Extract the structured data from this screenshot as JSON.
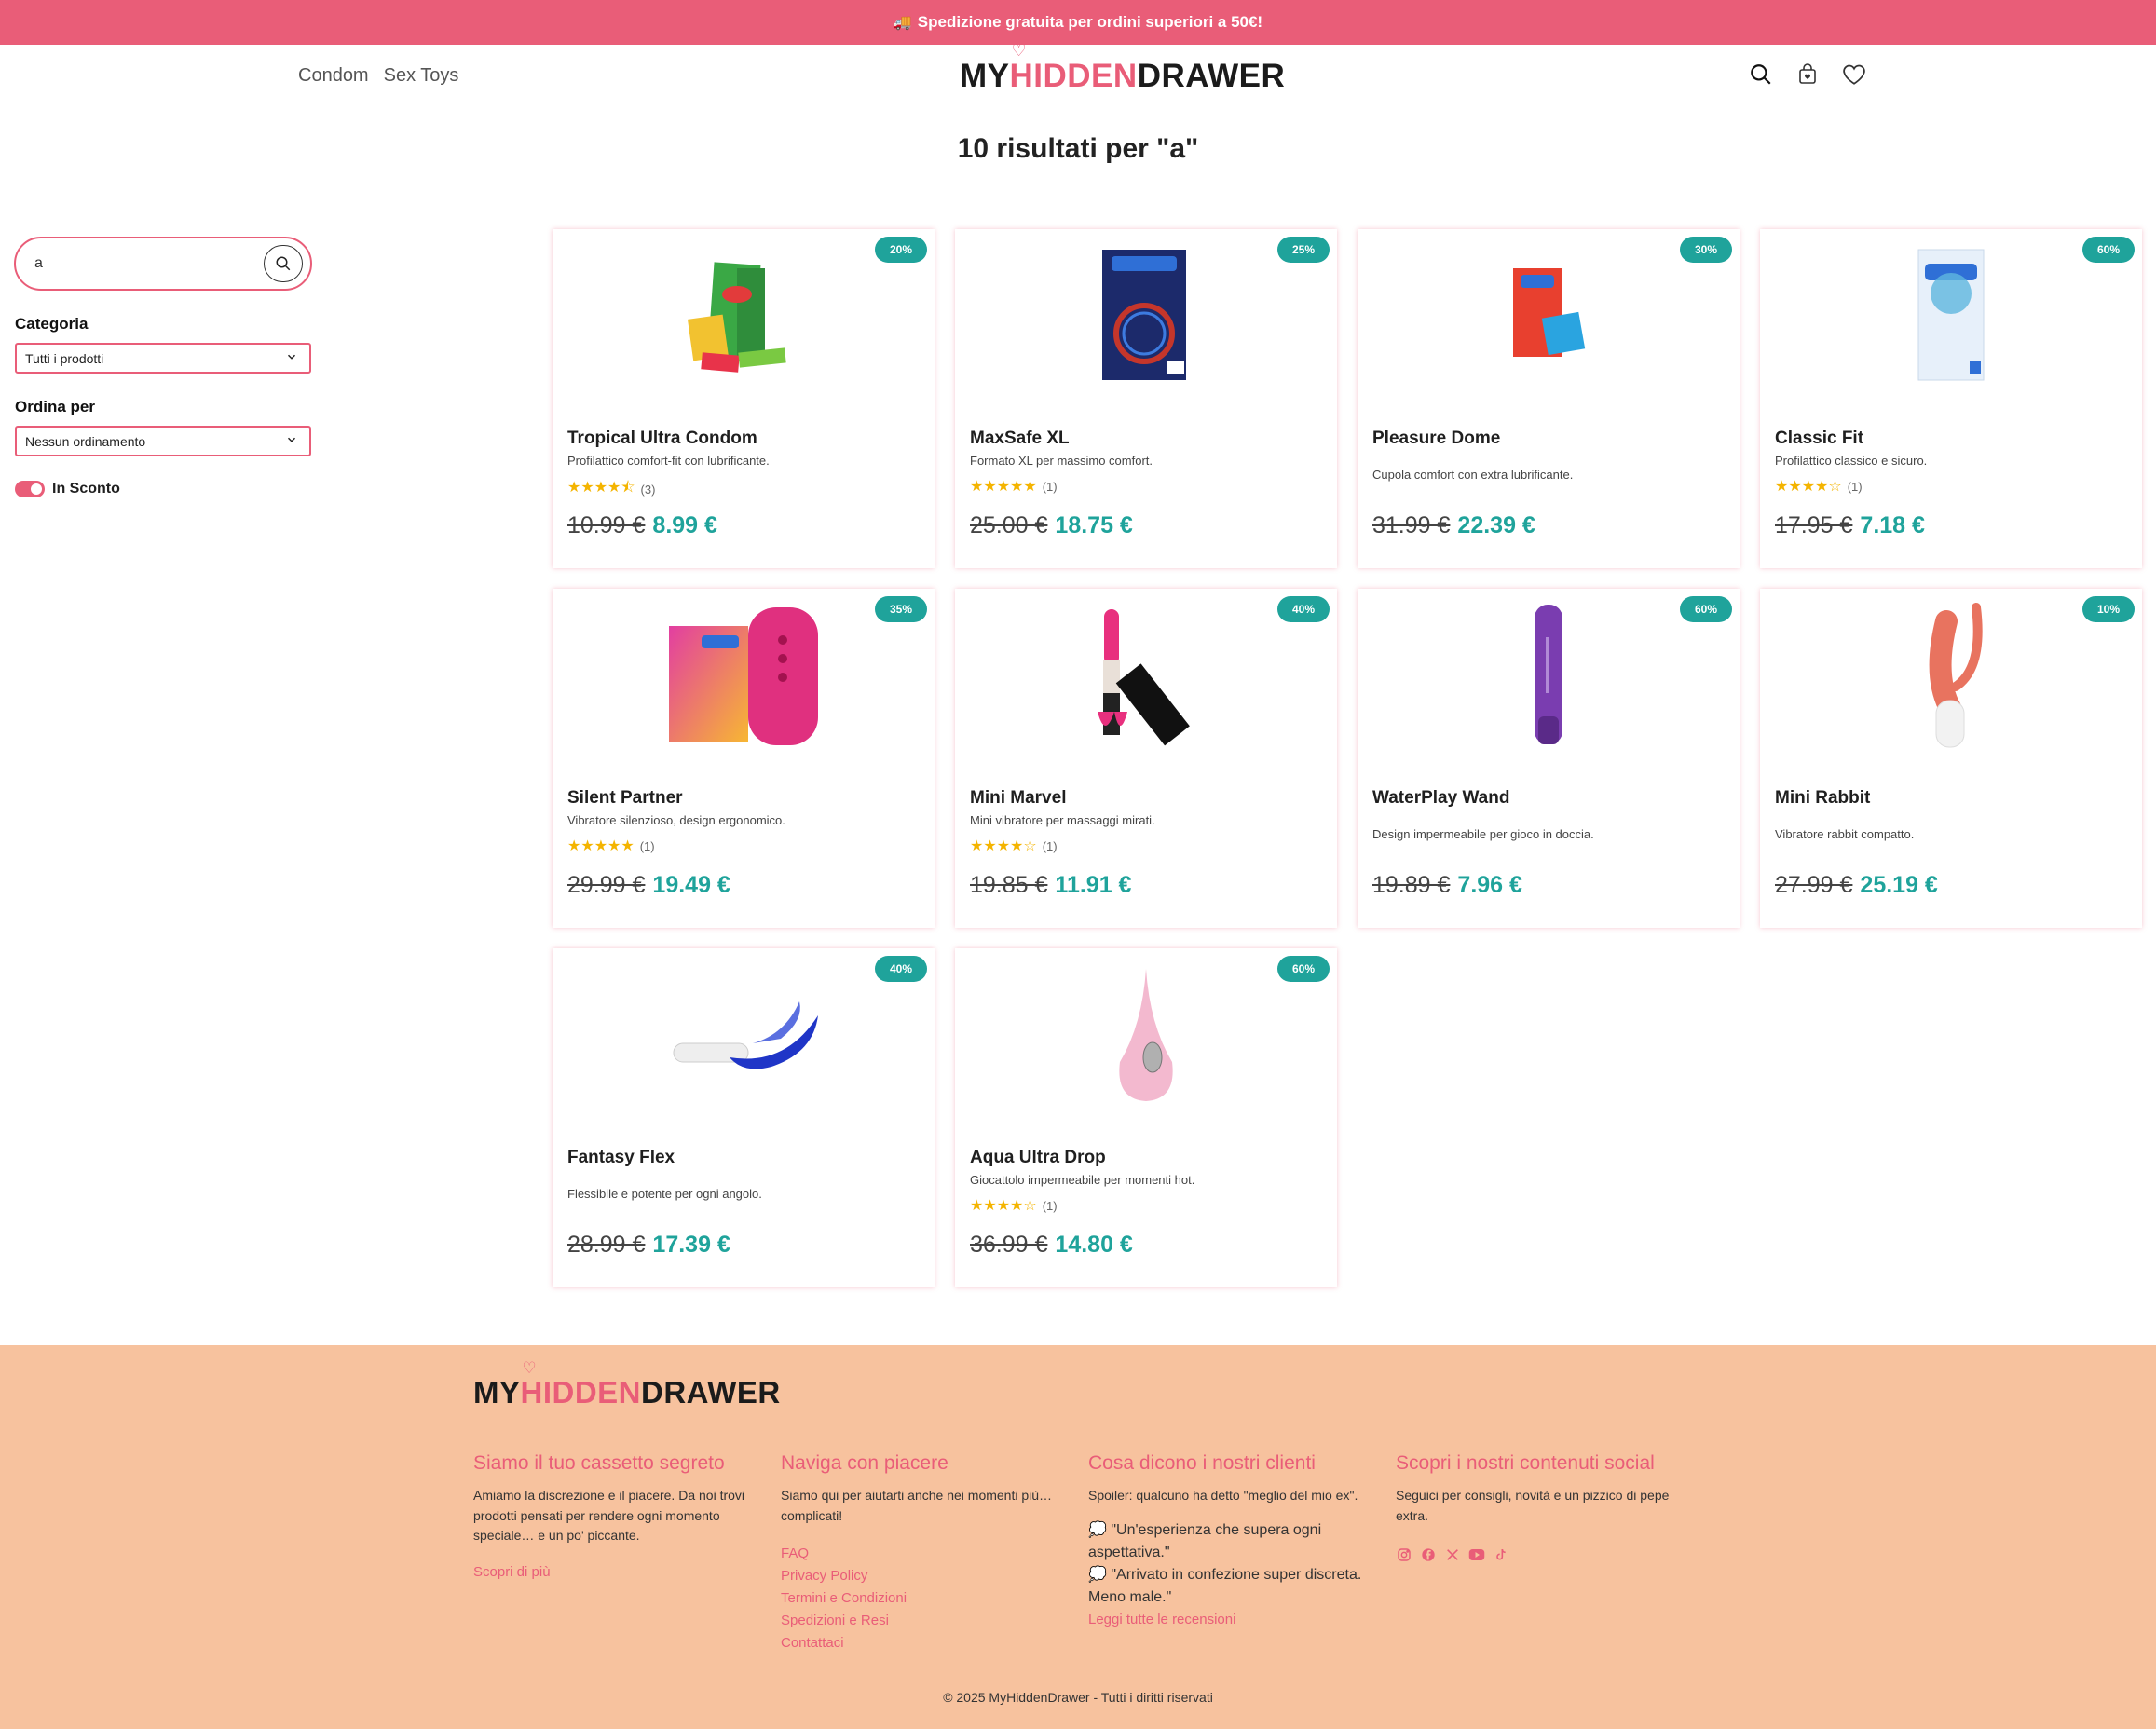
{
  "promo": {
    "icon": "truck-icon",
    "truck": "🚚",
    "text": "Spedizione gratuita per ordini superiori a 50€!"
  },
  "nav": {
    "items": [
      "Condom",
      "Sex Toys"
    ]
  },
  "logo": {
    "part1": "MY",
    "part2": "HIDDEN",
    "part3": "DRAWER"
  },
  "header_icons": [
    "search-icon",
    "bag-icon",
    "heart-icon"
  ],
  "results_title": "10 risultati per \"a\"",
  "search": {
    "value": "a"
  },
  "filters": {
    "category_label": "Categoria",
    "category_value": "Tutti i prodotti",
    "sort_label": "Ordina per",
    "sort_value": "Nessun ordinamento",
    "discount_label": "In Sconto",
    "discount_on": true
  },
  "products": [
    {
      "name": "Tropical Ultra Condom",
      "desc": "Profilattico comfort-fit con lubrificante.",
      "discount": "20%",
      "rating": 4.5,
      "reviews": "(3)",
      "old": "10.99 €",
      "new": "8.99 €"
    },
    {
      "name": "MaxSafe XL",
      "desc": "Formato XL per massimo comfort.",
      "discount": "25%",
      "rating": 5,
      "reviews": "(1)",
      "old": "25.00 €",
      "new": "18.75 €"
    },
    {
      "name": "Pleasure Dome",
      "desc": "Cupola comfort con extra lubrificante.",
      "discount": "30%",
      "rating": null,
      "reviews": "",
      "old": "31.99 €",
      "new": "22.39 €"
    },
    {
      "name": "Classic Fit",
      "desc": "Profilattico classico e sicuro.",
      "discount": "60%",
      "rating": 4,
      "reviews": "(1)",
      "old": "17.95 €",
      "new": "7.18 €"
    },
    {
      "name": "Silent Partner",
      "desc": "Vibratore silenzioso, design ergonomico.",
      "discount": "35%",
      "rating": 5,
      "reviews": "(1)",
      "old": "29.99 €",
      "new": "19.49 €"
    },
    {
      "name": "Mini Marvel",
      "desc": "Mini vibratore per massaggi mirati.",
      "discount": "40%",
      "rating": 4,
      "reviews": "(1)",
      "old": "19.85 €",
      "new": "11.91 €"
    },
    {
      "name": "WaterPlay Wand",
      "desc": "Design impermeabile per gioco in doccia.",
      "discount": "60%",
      "rating": null,
      "reviews": "",
      "old": "19.89 €",
      "new": "7.96 €"
    },
    {
      "name": "Mini Rabbit",
      "desc": "Vibratore rabbit compatto.",
      "discount": "10%",
      "rating": null,
      "reviews": "",
      "old": "27.99 €",
      "new": "25.19 €"
    },
    {
      "name": "Fantasy Flex",
      "desc": "Flessibile e potente per ogni angolo.",
      "discount": "40%",
      "rating": null,
      "reviews": "",
      "old": "28.99 €",
      "new": "17.39 €"
    },
    {
      "name": "Aqua Ultra Drop",
      "desc": "Giocattolo impermeabile per momenti hot.",
      "discount": "60%",
      "rating": 4,
      "reviews": "(1)",
      "old": "36.99 €",
      "new": "14.80 €"
    }
  ],
  "footer": {
    "col1": {
      "title": "Siamo il tuo cassetto segreto",
      "text": "Amiamo la discrezione e il piacere. Da noi trovi prodotti pensati per rendere ogni momento speciale… e un po' piccante.",
      "link": "Scopri di più"
    },
    "col2": {
      "title": "Naviga con piacere",
      "text": "Siamo qui per aiutarti anche nei momenti più… complicati!",
      "links": [
        "FAQ",
        "Privacy Policy",
        "Termini e Condizioni",
        "Spedizioni e Resi",
        "Contattaci"
      ]
    },
    "col3": {
      "title": "Cosa dicono i nostri clienti",
      "text": "Spoiler: qualcuno ha detto \"meglio del mio ex\".",
      "quotes": [
        "💭 \"Un'esperienza che supera ogni aspettativa.\"",
        "💭 \"Arrivato in confezione super discreta. Meno male.\""
      ],
      "link": "Leggi tutte le recensioni"
    },
    "col4": {
      "title": "Scopri i nostri contenuti social",
      "text": "Seguici per consigli, novità e un pizzico di pepe extra.",
      "socials": [
        "instagram-icon",
        "facebook-icon",
        "x-icon",
        "youtube-icon",
        "tiktok-icon"
      ]
    },
    "copyright": "© 2025 MyHiddenDrawer - Tutti i diritti riservati"
  }
}
